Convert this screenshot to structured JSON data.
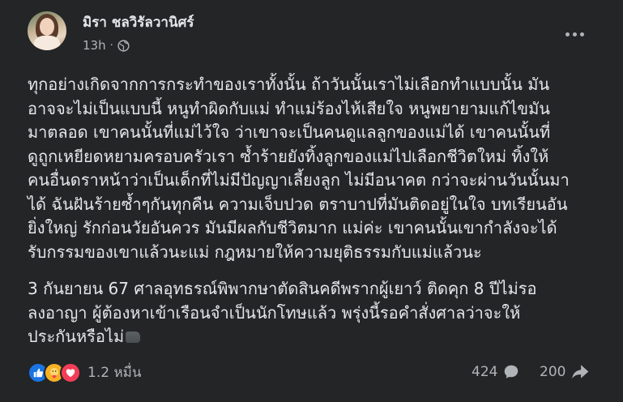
{
  "post": {
    "author": "มิรา ชลวิรัลวานิศร์",
    "time": "13h",
    "separator": "·",
    "paragraph1": "ทุกอย่างเกิดจากการกระทำของเราทั้งนั้น ถ้าวันนั้นเราไม่เลือกทำแบบนั้น มัน\nอาจจะไม่เป็นแบบนี้ หนูทำผิดกับแม่ ทำแม่ร้องไห้เสียใจ หนูพยายามแก้ไขมัน\nมาตลอด เขาคนนั้นที่แม่ไว้ใจ ว่าเขาจะเป็นคนดูแลลูกของแม่ได้ เขาคนนั้นที่\nดูถูกเหยียดหยามครอบครัวเรา ซ้ำร้ายยังทิ้งลูกของแม่ไปเลือกชีวิตใหม่ ทิ้งให้\nคนอื่นดราหน้าว่าเป็นเด็กที่ไม่มีปัญญาเลี้ยงลูก ไม่มีอนาคต กว่าจะผ่านวันนั้นมา\nได้ ฉันฝันร้ายซ้ำๆกันทุกคืน ความเจ็บปวด ตราบาปที่มันติดอยู่ในใจ บทเรียนอัน\nยิ่งใหญ่ รักก่อนวัยอันควร มันมีผลกับชีวิตมาก แม่ค่ะ เขาคนนั้นเขากำลังจะได้\nรับกรรมของเขาแล้วนะแม่ กฎหมายให้ความยุติธรรมกับแม่แล้วนะ",
    "paragraph2": "3 กันยายน 67  ศาลอุทธรณ์พิพากษาตัดสินคดีพรากผู้เยาว์ ติดคุก 8 ปีไม่รอ\nลงอาญา ผู้ต้องหาเข้าเรือนจำเป็นนักโทษแล้ว พรุ่งนี้รอคำสั่งศาลว่าจะให้\nประกันหรือไม่",
    "reaction_count": "1.2 หมื่น",
    "comment_count": "424",
    "share_count": "200"
  },
  "colors": {
    "background": "#242526",
    "text": "#e4e6eb",
    "secondary_text": "#b0b3b8",
    "like": "#1b74e4",
    "care": "#f7b125",
    "love": "#f33e58"
  },
  "icons": [
    "globe-icon",
    "more-icon",
    "like-icon",
    "care-icon",
    "love-icon",
    "comment-icon",
    "share-icon"
  ]
}
